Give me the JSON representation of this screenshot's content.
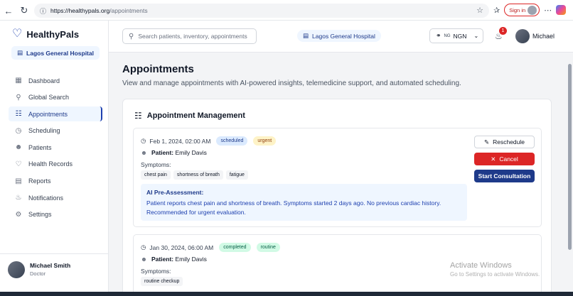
{
  "browser": {
    "url_host": "https://healthypals.org",
    "url_path": "/appointments",
    "sign_in_label": "Sign in"
  },
  "app": {
    "brand": "HealthyPals",
    "hospital": "Lagos General Hospital"
  },
  "sidebar": {
    "items": [
      {
        "label": "Dashboard",
        "icon": "grid-icon",
        "active": false
      },
      {
        "label": "Global Search",
        "icon": "search-icon",
        "active": false
      },
      {
        "label": "Appointments",
        "icon": "calendar-icon",
        "active": true
      },
      {
        "label": "Scheduling",
        "icon": "clock-icon",
        "active": false
      },
      {
        "label": "Patients",
        "icon": "users-icon",
        "active": false
      },
      {
        "label": "Health Records",
        "icon": "heart-icon",
        "active": false
      },
      {
        "label": "Reports",
        "icon": "file-icon",
        "active": false
      },
      {
        "label": "Notifications",
        "icon": "bell-icon",
        "active": false
      },
      {
        "label": "Settings",
        "icon": "gear-icon",
        "active": false
      }
    ],
    "user": {
      "name": "Michael Smith",
      "role": "Doctor"
    }
  },
  "header": {
    "search_placeholder": "Search patients, inventory, appointments",
    "hospital": "Lagos General Hospital",
    "currency_flag": "NG",
    "currency": "NGN",
    "notification_count": "1",
    "user_name": "Michael"
  },
  "main": {
    "title": "Appointments",
    "subtitle": "View and manage appointments with AI-powered insights, telemedicine support, and automated scheduling.",
    "panel_title": "Appointment Management",
    "appointments": [
      {
        "datetime": "Feb 1, 2024, 02:00 AM",
        "status": "scheduled",
        "priority": "urgent",
        "patient_label": "Patient:",
        "patient_name": "Emily Davis",
        "symptoms_label": "Symptoms:",
        "symptoms": [
          "chest pain",
          "shortness of breath",
          "fatigue"
        ],
        "ai_title": "AI Pre-Assessment:",
        "ai_text": "Patient reports chest pain and shortness of breath. Symptoms started 2 days ago. No previous cardiac history. Recommended for urgent evaluation."
      },
      {
        "datetime": "Jan 30, 2024, 06:00 AM",
        "status": "completed",
        "priority": "routine",
        "patient_label": "Patient:",
        "patient_name": "Emily Davis",
        "symptoms_label": "Symptoms:",
        "symptoms": [
          "routine checkup"
        ]
      }
    ],
    "actions": {
      "reschedule": "Reschedule",
      "cancel": "Cancel",
      "start": "Start Consultation"
    }
  },
  "watermark": {
    "title": "Activate Windows",
    "subtitle": "Go to Settings to activate Windows."
  },
  "colors": {
    "primary": "#1e3a8a",
    "danger": "#dc2626",
    "accent_bg": "#eff6ff"
  }
}
